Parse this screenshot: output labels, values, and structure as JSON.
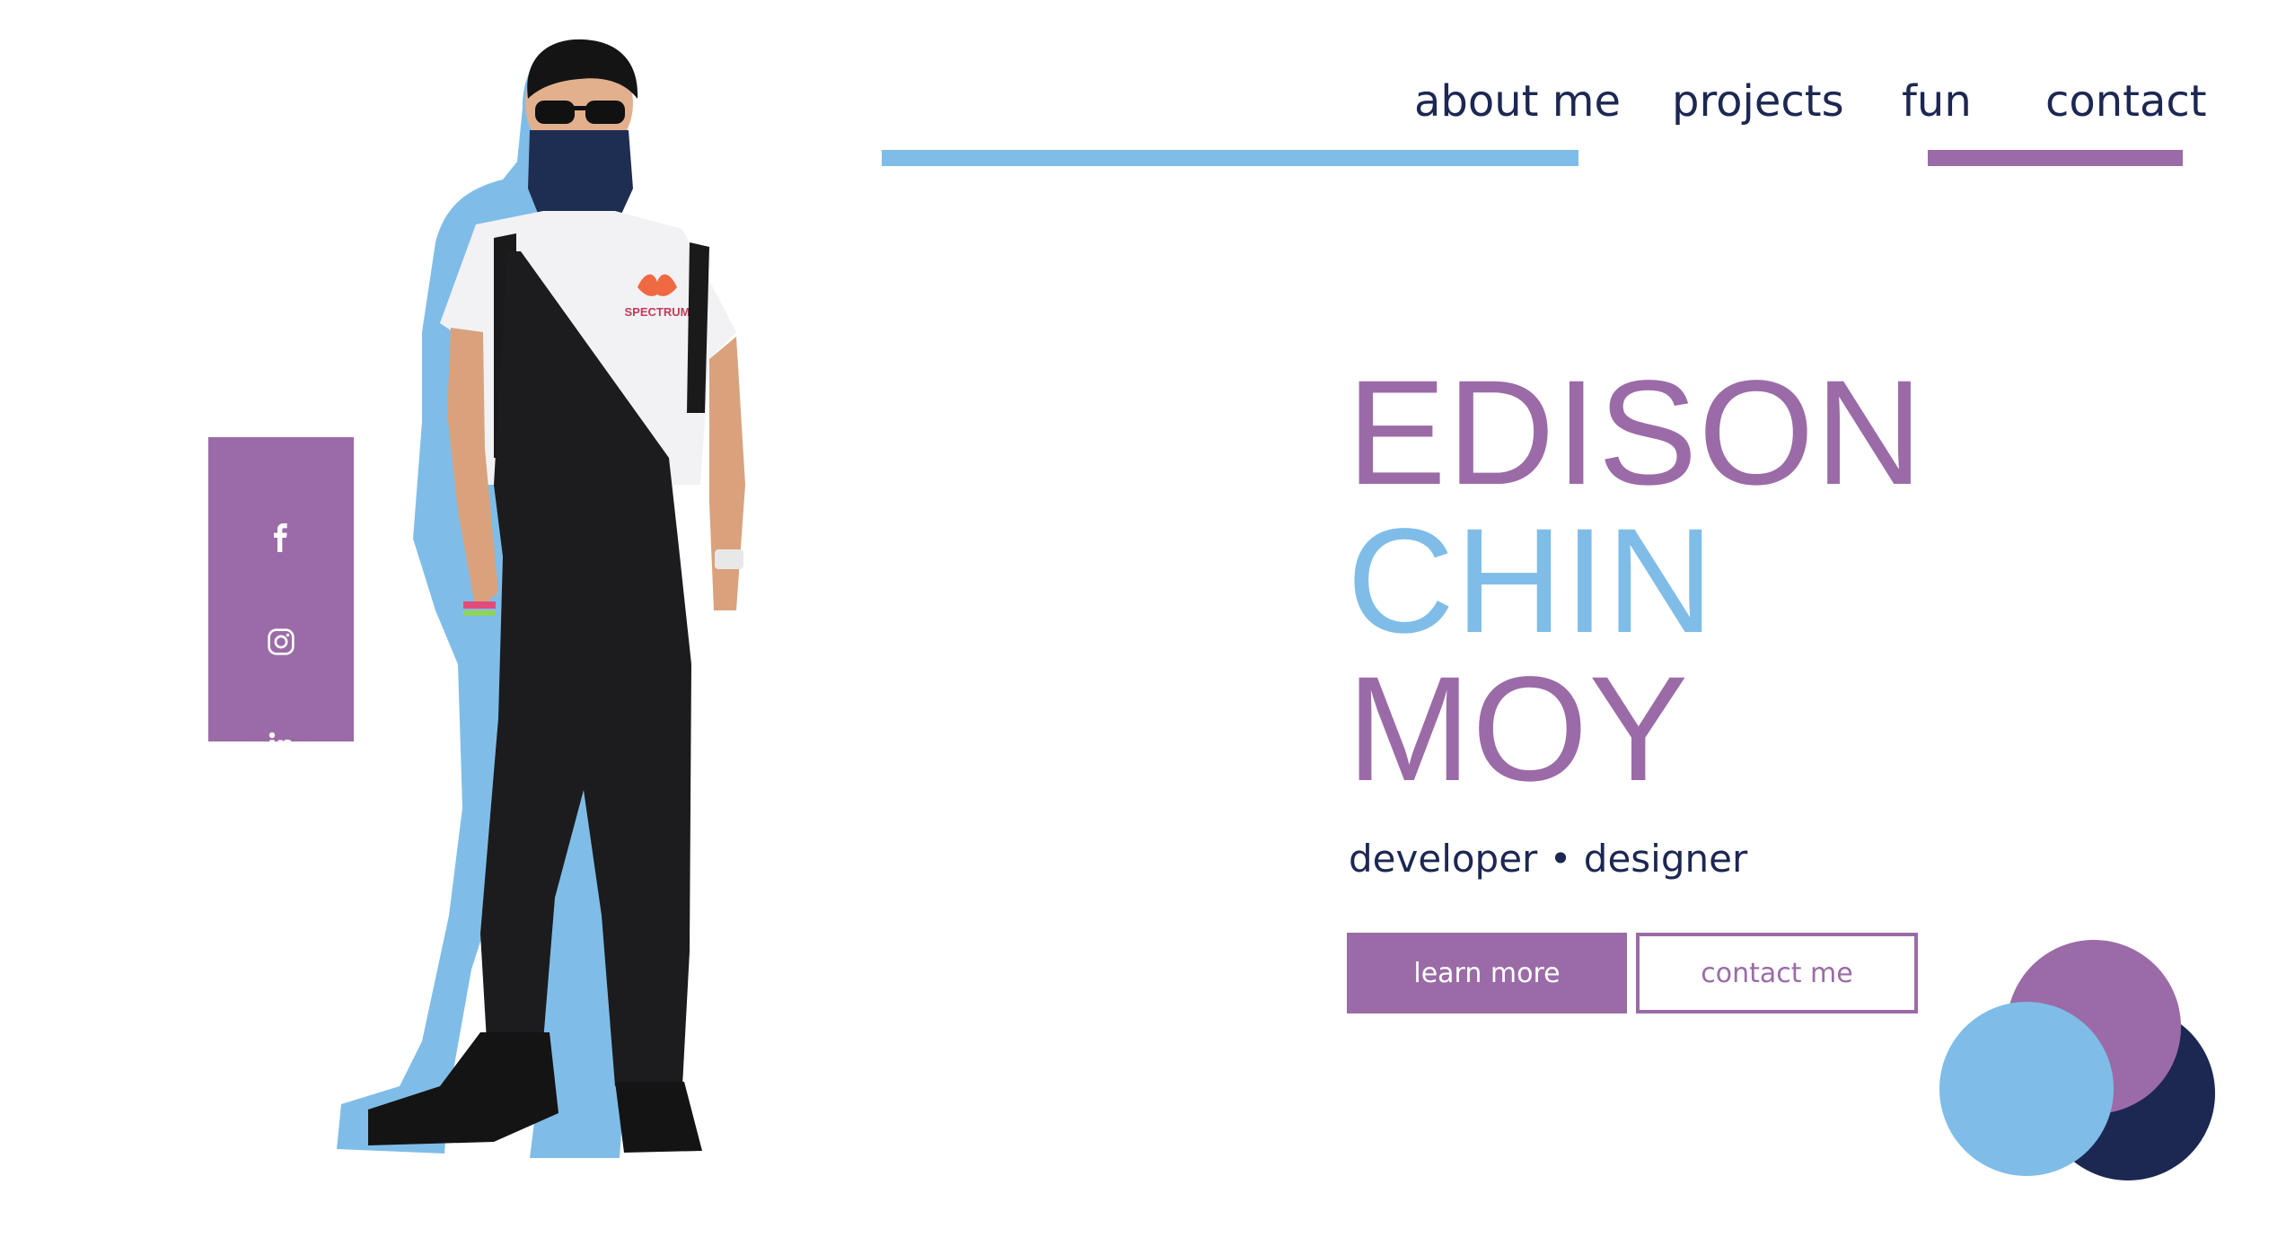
{
  "nav": {
    "items": [
      {
        "label": "about me"
      },
      {
        "label": "projects"
      },
      {
        "label": "fun"
      },
      {
        "label": "contact"
      }
    ]
  },
  "social": [
    {
      "icon": "facebook-icon"
    },
    {
      "icon": "instagram-icon"
    },
    {
      "icon": "linkedin-icon"
    }
  ],
  "hero": {
    "name_first": "EDISON",
    "name_middle": "CHIN",
    "name_last": "MOY",
    "subtitle": "developer • designer",
    "learn_more": "learn more",
    "contact_me": "contact me"
  },
  "photo": {
    "shirt_text": "SPECTRUM"
  },
  "colors": {
    "purple": "#9b6ba7",
    "blue": "#7fbde8",
    "navy": "#1c2752"
  }
}
